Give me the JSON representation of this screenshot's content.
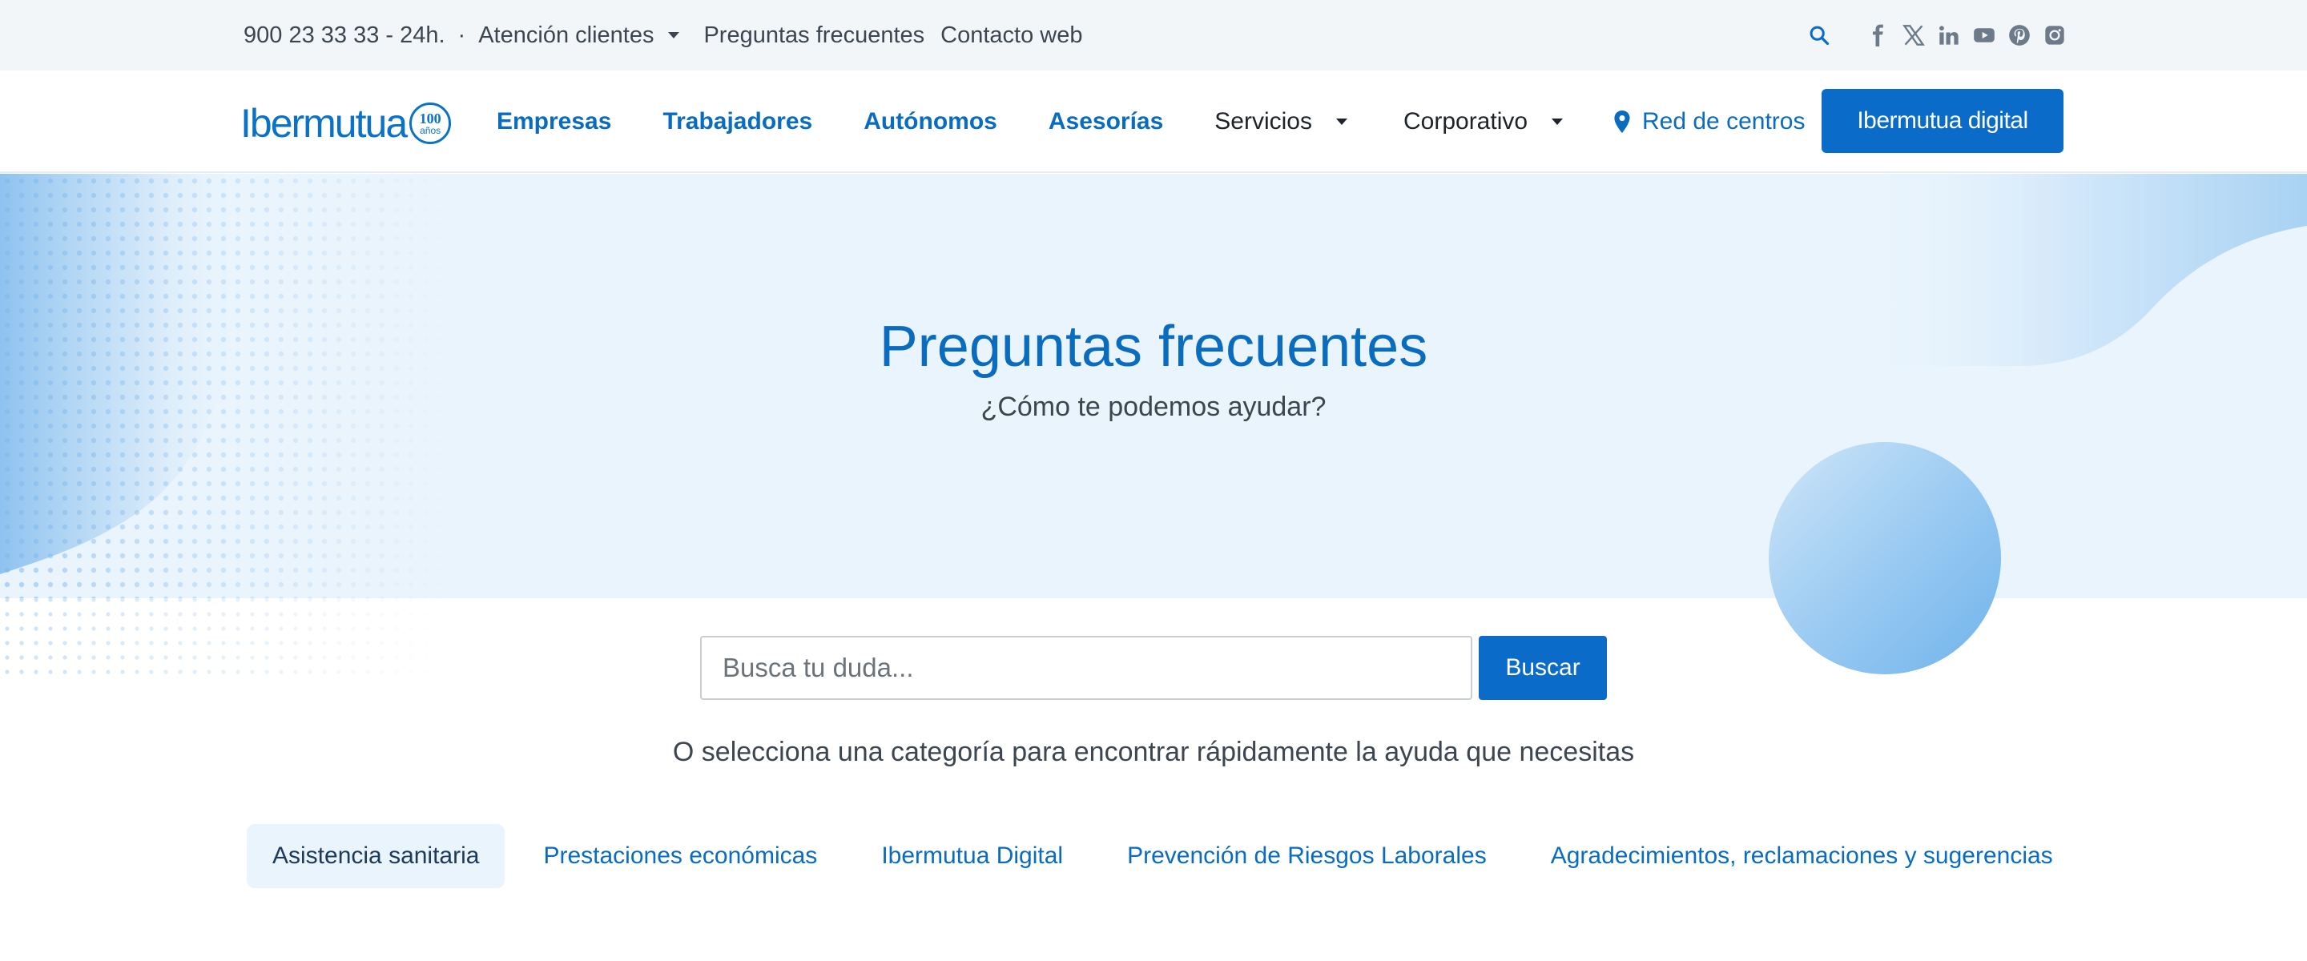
{
  "topbar": {
    "phone": "900 23 33 33 - 24h.",
    "separator": "·",
    "atencion": "Atención clientes",
    "faq": "Preguntas frecuentes",
    "contact": "Contacto web",
    "icons": [
      "search-icon",
      "facebook-icon",
      "x-icon",
      "linkedin-icon",
      "youtube-icon",
      "pinterest-icon",
      "instagram-icon"
    ]
  },
  "nav": {
    "logo_text": "Ibermutua",
    "logo_badge_number": "100",
    "logo_badge_text": "años",
    "items": [
      "Empresas",
      "Trabajadores",
      "Autónomos",
      "Asesorías",
      "Servicios",
      "Corporativo"
    ],
    "red_centros": "Red de centros",
    "digital_button": "Ibermutua digital"
  },
  "hero": {
    "title": "Preguntas frecuentes",
    "subtitle": "¿Cómo te podemos ayudar?"
  },
  "search": {
    "placeholder": "Busca tu duda...",
    "button": "Buscar",
    "select_text": "O selecciona una categoría para encontrar rápidamente la ayuda que necesitas"
  },
  "categories": [
    "Asistencia sanitaria",
    "Prestaciones económicas",
    "Ibermutua Digital",
    "Prevención de Riesgos Laborales",
    "Agradecimientos, reclamaciones y sugerencias"
  ],
  "colors": {
    "brand_blue": "#0a6cc8",
    "link_blue": "#0a6cbf",
    "hero_bg": "#e9f4fd",
    "topbar_bg": "#f3f6f9"
  }
}
